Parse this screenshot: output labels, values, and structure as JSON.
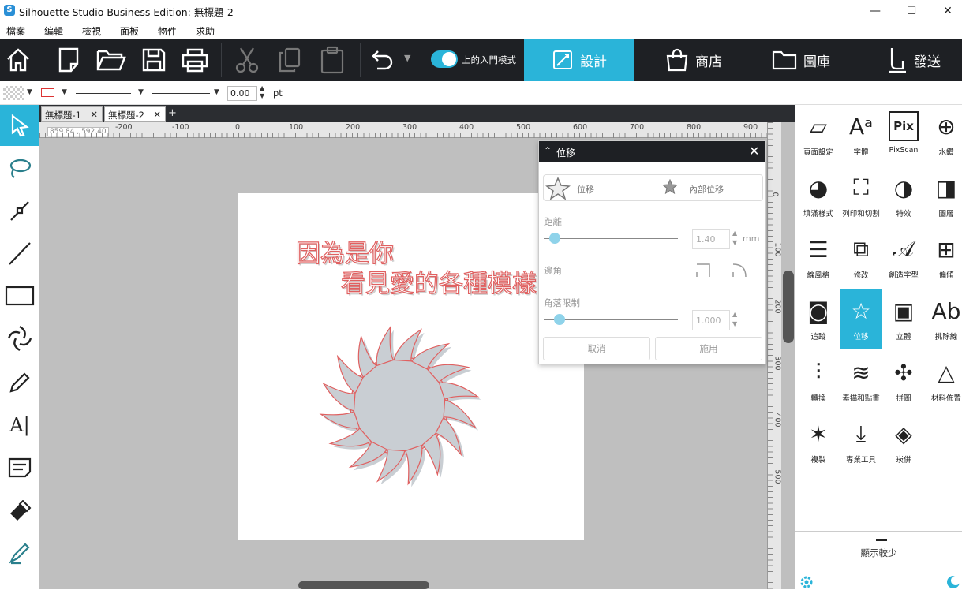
{
  "window": {
    "title": "Silhouette Studio Business Edition: 無標題-2",
    "minimize": "—",
    "maximize": "☐",
    "close": "✕"
  },
  "menu": [
    "檔案",
    "編輯",
    "檢視",
    "面板",
    "物件",
    "求助"
  ],
  "toolbar": {
    "toggle_label": "上的入門模式"
  },
  "nav_tabs": [
    {
      "label": "設計",
      "active": true
    },
    {
      "label": "商店"
    },
    {
      "label": "圖庫"
    },
    {
      "label": "發送"
    }
  ],
  "props": {
    "line_width": "0.00",
    "unit": "pt"
  },
  "doc_tabs": [
    {
      "label": "無標題-1"
    },
    {
      "label": "無標題-2"
    }
  ],
  "doc_tab_add": "+",
  "cursor_readout": "859.84 , 592.40",
  "ruler_h": [
    "-200",
    "-100",
    "0",
    "100",
    "200",
    "300",
    "400",
    "500",
    "600",
    "700",
    "800",
    "900"
  ],
  "ruler_v": [
    "0",
    "100",
    "200",
    "300",
    "400",
    "500"
  ],
  "canvas_text": {
    "line1": "因為是你",
    "line2": "看見愛的各種模樣"
  },
  "offset_panel": {
    "title": "位移",
    "offset_label": "位移",
    "internal_offset_label": "內部位移",
    "distance_label": "距離",
    "distance_value": "1.40",
    "distance_unit": "mm",
    "distance_level": 0.08,
    "corner_label": "邊角",
    "corner_limit_label": "角落限制",
    "corner_limit_value": "1.000",
    "corner_limit_level": 0.12,
    "cancel": "取消",
    "apply": "施用"
  },
  "right_panel": {
    "items": [
      {
        "label": "頁面設定",
        "icon": "page-setup-icon"
      },
      {
        "label": "字體",
        "icon": "font-icon"
      },
      {
        "label": "PixScan",
        "icon": "pixscan-icon"
      },
      {
        "label": "水鑽",
        "icon": "rhinestone-icon"
      },
      {
        "label": "填滿樣式",
        "icon": "fill-icon"
      },
      {
        "label": "列印和切割",
        "icon": "print-cut-icon"
      },
      {
        "label": "特效",
        "icon": "effects-icon"
      },
      {
        "label": "圖層",
        "icon": "layers-icon"
      },
      {
        "label": "線風格",
        "icon": "line-style-icon"
      },
      {
        "label": "修改",
        "icon": "modify-icon"
      },
      {
        "label": "創造字型",
        "icon": "create-font-icon"
      },
      {
        "label": "偏傾",
        "icon": "warp-icon"
      },
      {
        "label": "追蹤",
        "icon": "trace-icon"
      },
      {
        "label": "位移",
        "icon": "offset-icon",
        "active": true
      },
      {
        "label": "立體",
        "icon": "3d-icon"
      },
      {
        "label": "挑除線",
        "icon": "weed-lines-icon"
      },
      {
        "label": "轉換",
        "icon": "transform-icon"
      },
      {
        "label": "素描和點畫",
        "icon": "sketch-icon"
      },
      {
        "label": "拼圖",
        "icon": "puzzle-icon"
      },
      {
        "label": "材料佈置",
        "icon": "nesting-icon"
      },
      {
        "label": "複製",
        "icon": "replicate-icon"
      },
      {
        "label": "專業工具",
        "icon": "pro-tools-icon"
      },
      {
        "label": "崁併",
        "icon": "merge-icon"
      }
    ],
    "show_less": "顯示較少"
  },
  "colors": {
    "accent": "#2ab4d9",
    "toolbar_bg": "#1e2024",
    "text_red": "#e06060"
  }
}
